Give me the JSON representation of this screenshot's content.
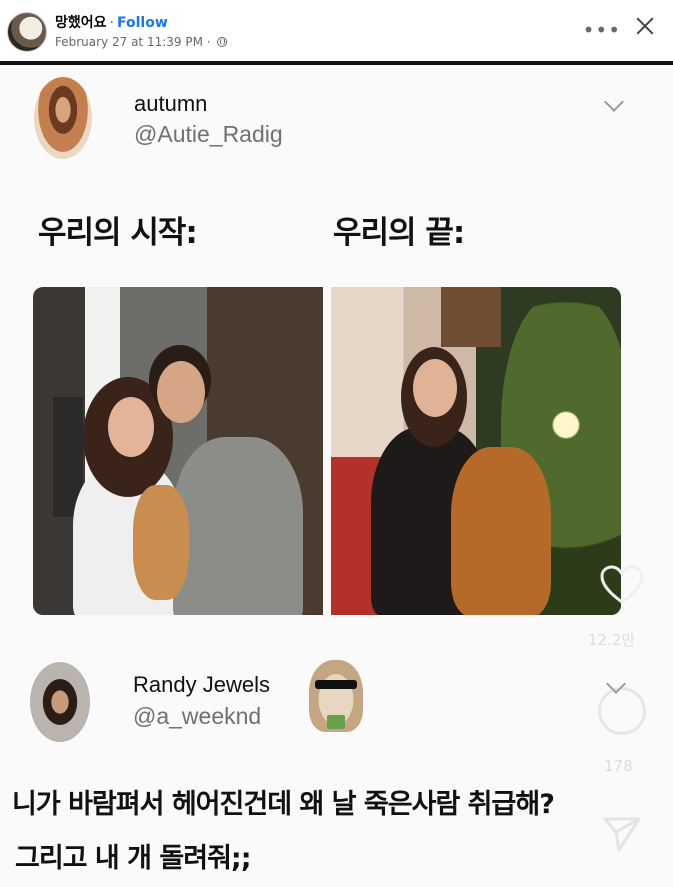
{
  "post": {
    "author": "망했어요",
    "separator": "·",
    "follow_label": "Follow",
    "timestamp": "February 27 at 11:39 PM",
    "meta_separator": "·",
    "more_icon": "more-horizontal-icon",
    "close_icon": "close-icon",
    "privacy_icon": "globe-icon"
  },
  "tweet1": {
    "name": "autumn",
    "handle": "@Autie_Radig",
    "caption_left": "우리의 시작:",
    "caption_right": "우리의 끝:"
  },
  "tweet2": {
    "name": "Randy Jewels",
    "handle": "@a_weeknd",
    "line1": "니가 바람펴서 헤어진건데  왜 날 죽은사람 취급해?",
    "line2": "그리고 내 개 돌려줘;;"
  },
  "overlay": {
    "likes": "12.2만",
    "comments": "178",
    "heart_icon": "heart-icon",
    "comment_icon": "comment-icon",
    "send_icon": "send-icon"
  },
  "colors": {
    "follow": "#1877f2",
    "meta": "#65676b",
    "handle": "#707070"
  }
}
